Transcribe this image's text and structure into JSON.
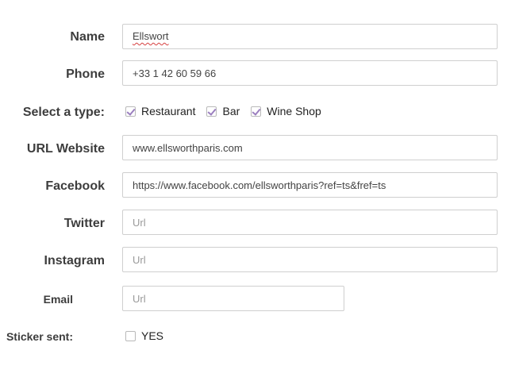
{
  "form": {
    "name": {
      "label": "Name",
      "value": "Ellswort"
    },
    "phone": {
      "label": "Phone",
      "value": "+33 1 42 60 59 66"
    },
    "type": {
      "label": "Select a type:",
      "options": [
        {
          "label": "Restaurant",
          "checked": true
        },
        {
          "label": "Bar",
          "checked": true
        },
        {
          "label": "Wine Shop",
          "checked": true
        }
      ]
    },
    "website": {
      "label": "URL Website",
      "value": "www.ellsworthparis.com"
    },
    "facebook": {
      "label": "Facebook",
      "value": "https://www.facebook.com/ellsworthparis?ref=ts&fref=ts"
    },
    "twitter": {
      "label": "Twitter",
      "placeholder": "Url"
    },
    "instagram": {
      "label": "Instagram",
      "placeholder": "Url"
    },
    "email": {
      "label": "Email",
      "placeholder": "Url"
    },
    "sticker": {
      "label": "Sticker sent:",
      "option_label": "YES",
      "checked": false
    }
  },
  "colors": {
    "check_accent": "#9b7fbf",
    "spell_error": "#d64040"
  }
}
